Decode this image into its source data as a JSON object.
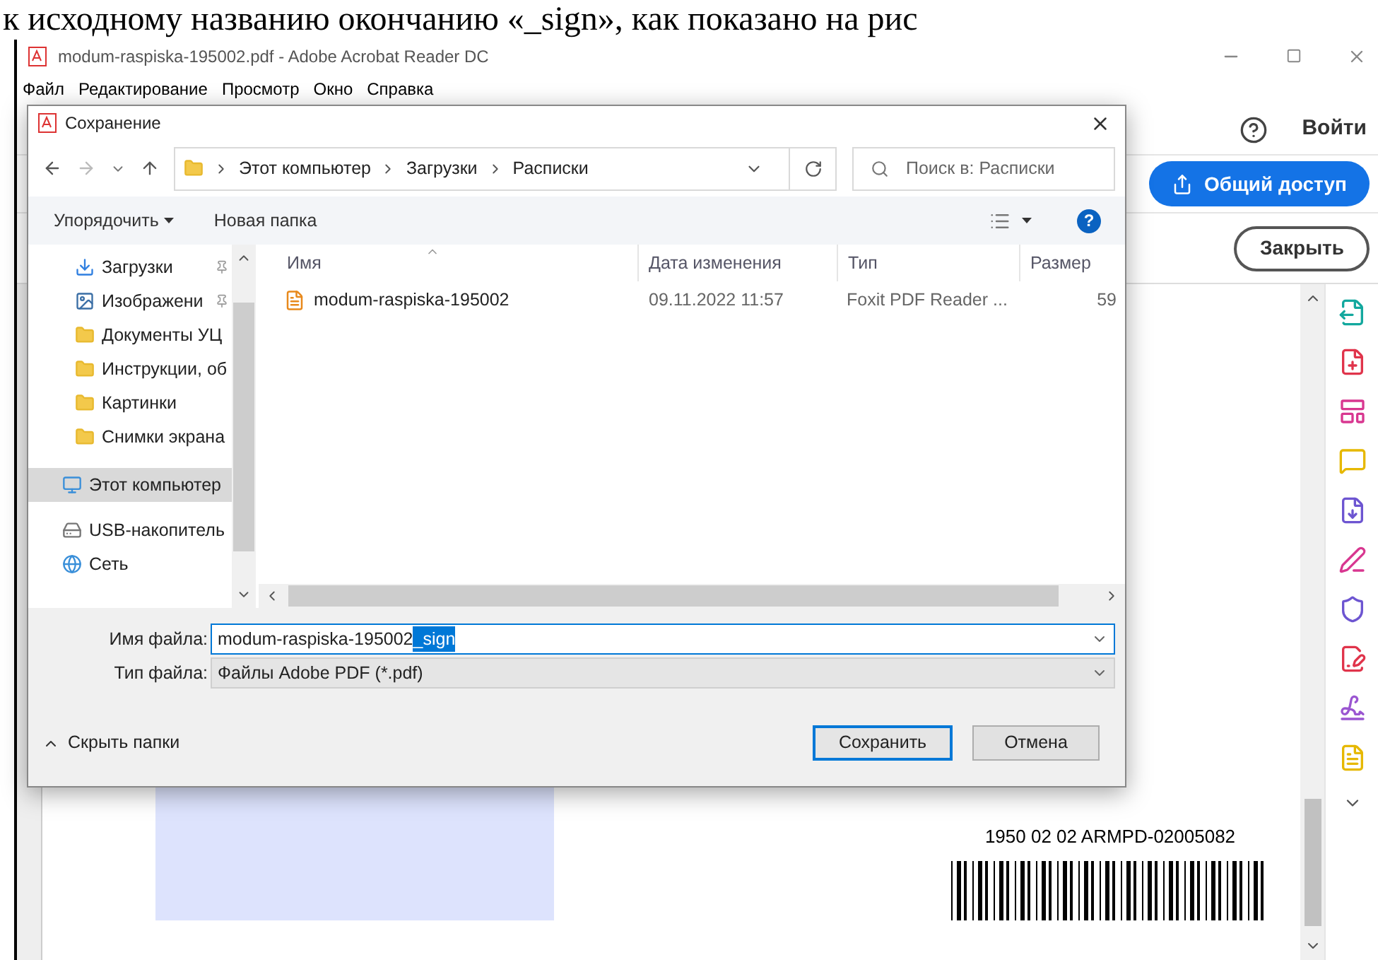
{
  "page_caption": "к исходному названию окончанию «_sign», как показано на рис",
  "window": {
    "title": "modum-raspiska-195002.pdf - Adobe Acrobat Reader DC",
    "menu": [
      "Файл",
      "Редактирование",
      "Просмотр",
      "Окно",
      "Справка"
    ]
  },
  "acrobat": {
    "sign_in": "Войти",
    "share": "Общий доступ",
    "close": "Закрыть"
  },
  "dialog": {
    "title": "Сохранение",
    "breadcrumb": [
      "Этот компьютер",
      "Загрузки",
      "Расписки"
    ],
    "search": {
      "placeholder": "Поиск в: Расписки"
    },
    "toolbar": {
      "organize": "Упорядочить",
      "new_folder": "Новая папка"
    },
    "nav_items": [
      {
        "label": "Загрузки",
        "kind": "download",
        "pinned": true,
        "selected": false
      },
      {
        "label": "Изображени",
        "kind": "images",
        "pinned": true,
        "selected": false
      },
      {
        "label": "Документы УЦ",
        "kind": "folder",
        "pinned": false,
        "selected": false
      },
      {
        "label": "Инструкции, об",
        "kind": "folder",
        "pinned": false,
        "selected": false
      },
      {
        "label": "Картинки",
        "kind": "folder",
        "pinned": false,
        "selected": false
      },
      {
        "label": "Снимки экрана",
        "kind": "folder",
        "pinned": false,
        "selected": false
      },
      {
        "label": "Этот компьютер",
        "kind": "computer",
        "pinned": false,
        "selected": true
      },
      {
        "label": "USB-накопитель",
        "kind": "usb",
        "pinned": false,
        "selected": false
      },
      {
        "label": "Сеть",
        "kind": "network",
        "pinned": false,
        "selected": false
      }
    ],
    "columns": [
      "Имя",
      "Дата изменения",
      "Тип",
      "Размер"
    ],
    "files": [
      {
        "name": "modum-raspiska-195002",
        "date": "09.11.2022 11:57",
        "type": "Foxit PDF Reader ...",
        "size": "59"
      }
    ],
    "filename_label": "Имя файла:",
    "filename": {
      "value": "modum-raspiska-195002",
      "selected_part": "_sign"
    },
    "filetype_label": "Тип файла:",
    "filetype": "Файлы Adobe PDF (*.pdf)",
    "hide_folders": "Скрыть папки",
    "save": "Сохранить",
    "cancel": "Отмена",
    "help": "?"
  },
  "document": {
    "barcode_text": "1950 02 02 ARMPD-02005082"
  }
}
